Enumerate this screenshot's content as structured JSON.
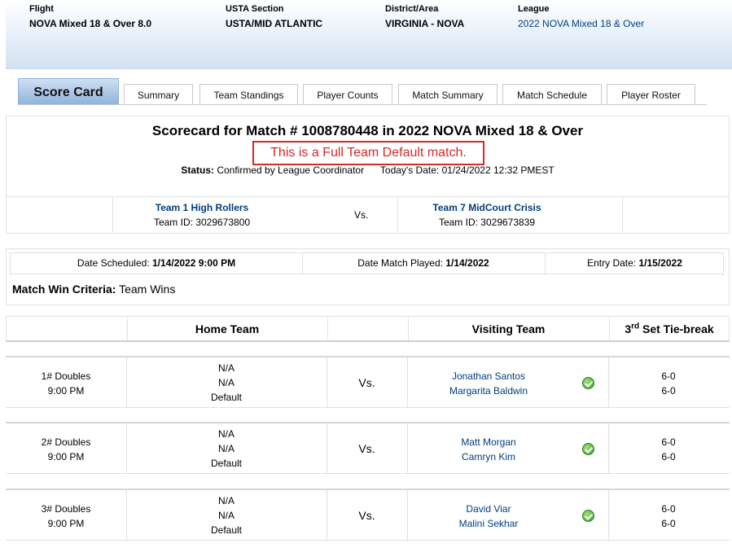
{
  "header": {
    "flight_label": "Flight",
    "flight_value": "NOVA Mixed 18 & Over 8.0",
    "section_label": "USTA Section",
    "section_value": "USTA/MID ATLANTIC",
    "district_label": "District/Area",
    "district_value": "VIRGINIA - NOVA",
    "league_label": "League",
    "league_value": "2022 NOVA Mixed 18 & Over"
  },
  "tabs": [
    {
      "label": "Score Card",
      "active": true
    },
    {
      "label": "Summary"
    },
    {
      "label": "Team Standings"
    },
    {
      "label": "Player Counts"
    },
    {
      "label": "Match Summary"
    },
    {
      "label": "Match Schedule"
    },
    {
      "label": "Player Roster"
    }
  ],
  "scorecard": {
    "title": "Scorecard for Match # 1008780448 in 2022 NOVA Mixed 18 & Over",
    "default_notice": "This is a Full Team Default match.",
    "status_label": "Status:",
    "status_value": "Confirmed by League Coordinator",
    "today_label": "Today's Date:",
    "today_value": "01/24/2022 12:32 PMEST",
    "home_team": {
      "name": "Team 1 High Rollers",
      "id_label": "Team ID:",
      "id": "3029673800"
    },
    "vs": "Vs.",
    "visiting_team": {
      "name": "Team 7 MidCourt Crisis",
      "id_label": "Team ID:",
      "id": "3029673839"
    }
  },
  "dates": {
    "scheduled_label": "Date Scheduled:",
    "scheduled_value": "1/14/2022 9:00 PM",
    "played_label": "Date Match Played:",
    "played_value": "1/14/2022",
    "entry_label": "Entry Date:",
    "entry_value": "1/15/2022",
    "criteria_label": "Match Win Criteria:",
    "criteria_value": "Team Wins"
  },
  "match_table": {
    "home_header": "Home Team",
    "visiting_header": "Visiting Team",
    "tiebreak_prefix": "3",
    "tiebreak_sup": "rd",
    "tiebreak_suffix": " Set Tie-break",
    "lines": [
      {
        "line": "1# Doubles",
        "time": "9:00 PM",
        "home": [
          "N/A",
          "N/A",
          "Default"
        ],
        "vs": "Vs.",
        "visitors": [
          "Jonathan Santos",
          "Margarita Baldwin"
        ],
        "winner_icon": "green-check-icon",
        "scores": [
          "6-0",
          "6-0"
        ]
      },
      {
        "line": "2# Doubles",
        "time": "9:00 PM",
        "home": [
          "N/A",
          "N/A",
          "Default"
        ],
        "vs": "Vs.",
        "visitors": [
          "Matt Morgan",
          "Camryn Kim"
        ],
        "winner_icon": "green-check-icon",
        "scores": [
          "6-0",
          "6-0"
        ]
      },
      {
        "line": "3# Doubles",
        "time": "9:00 PM",
        "home": [
          "N/A",
          "N/A",
          "Default"
        ],
        "vs": "Vs.",
        "visitors": [
          "David Viar",
          "Malini Sekhar"
        ],
        "winner_icon": "green-check-icon",
        "scores": [
          "6-0",
          "6-0"
        ]
      }
    ]
  }
}
